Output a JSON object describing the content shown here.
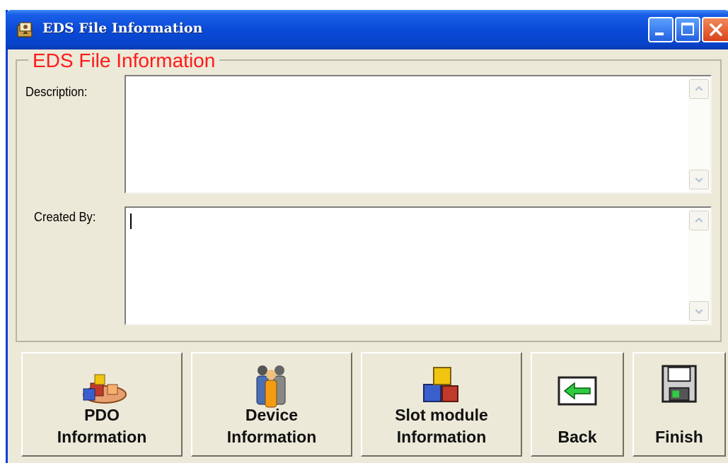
{
  "window": {
    "title": "EDS File Information",
    "icon": "folder-app-icon"
  },
  "group": {
    "legend": "EDS File Information",
    "legend_color": "#ff1a1a"
  },
  "fields": {
    "description": {
      "label": "Description:",
      "value": ""
    },
    "created_by": {
      "label": "Created By:",
      "value": ""
    }
  },
  "buttons": {
    "pdo": {
      "label": "PDO\nInformation",
      "icon": "pdo-icon"
    },
    "device": {
      "label": "Device\nInformation",
      "icon": "people-icon"
    },
    "slot": {
      "label": "Slot module\nInformation",
      "icon": "cubes-icon"
    },
    "back": {
      "label": "Back",
      "icon": "back-arrow-icon"
    },
    "finish": {
      "label": "Finish",
      "icon": "floppy-disk-icon"
    }
  },
  "colors": {
    "titlebar": "#0a4ad8",
    "face": "#ece9d8"
  }
}
